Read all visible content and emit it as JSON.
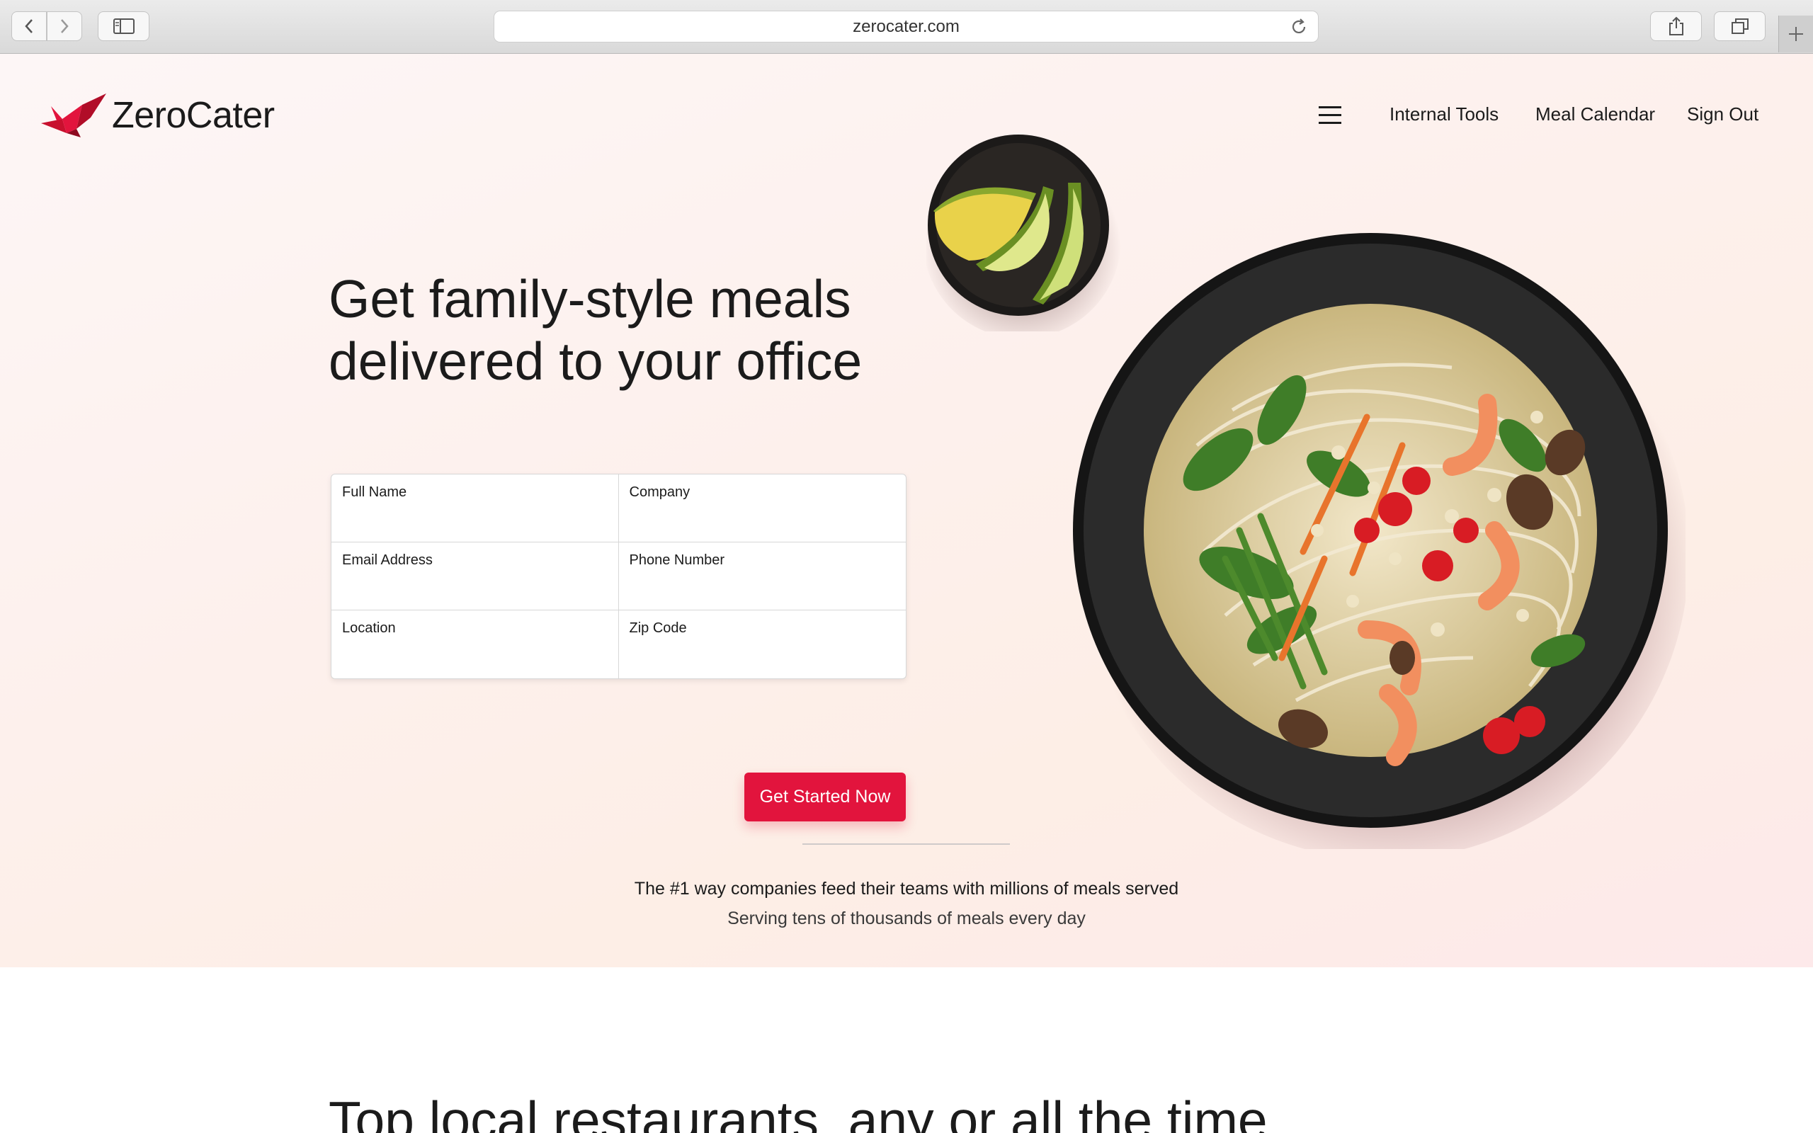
{
  "browser": {
    "url": "zerocater.com",
    "icons": [
      "back-icon",
      "forward-icon",
      "sidebar-icon",
      "reload-icon",
      "share-icon",
      "tabs-icon",
      "new-tab-icon"
    ]
  },
  "header": {
    "logo_text": "ZeroCater",
    "nav": {
      "menu_icon": "hamburger-icon",
      "internal_tools": "Internal Tools",
      "meal_calendar": "Meal Calendar",
      "sign_out": "Sign Out"
    }
  },
  "hero": {
    "headline_line1": "Get family-style meals",
    "headline_line2": "delivered to your office",
    "form": {
      "full_name": "Full Name",
      "company": "Company",
      "email": "Email Address",
      "phone": "Phone Number",
      "location": "Location",
      "zip": "Zip Code"
    },
    "cta": "Get Started Now",
    "tagline": "The #1 way companies feed their teams with millions of meals served",
    "subtagline": "Serving tens of thousands of meals every day"
  },
  "section2": {
    "heading": "Top local restaurants, any or all the time"
  },
  "colors": {
    "brand_red": "#e2143d",
    "text": "#1b1b1b"
  }
}
